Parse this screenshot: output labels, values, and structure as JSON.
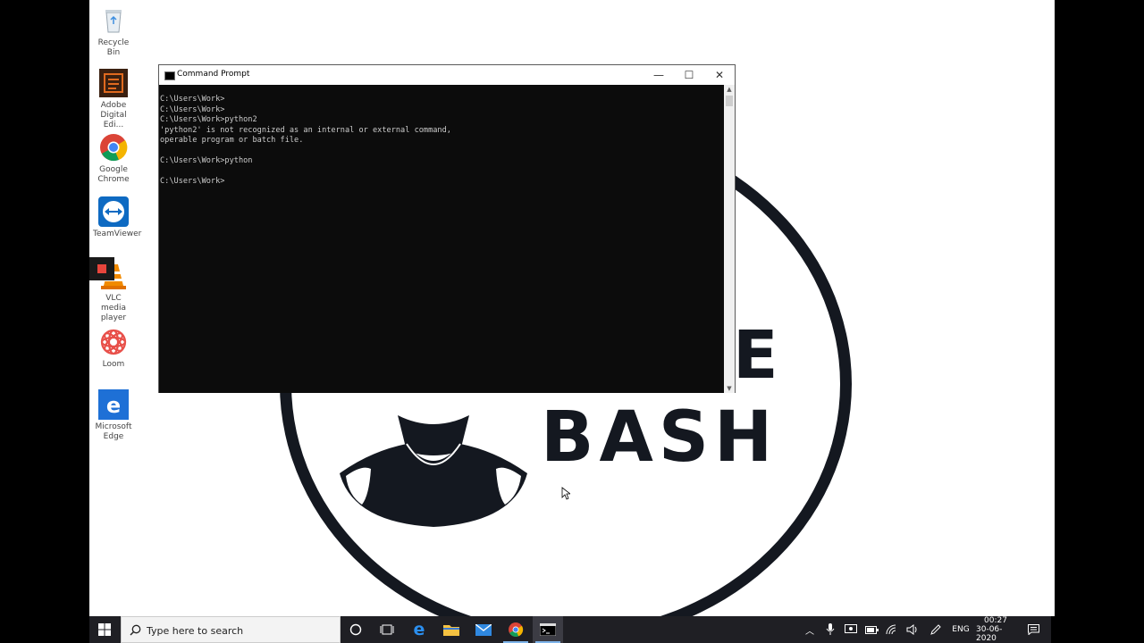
{
  "desktop_icons": [
    {
      "label": "Recycle Bin"
    },
    {
      "label": "Adobe Digital Edi..."
    },
    {
      "label": "Google Chrome"
    },
    {
      "label": "TeamViewer"
    },
    {
      "label": "VLC media player"
    },
    {
      "label": "Loom"
    },
    {
      "label": "Microsoft Edge"
    }
  ],
  "wallpaper": {
    "logo_letter": "E",
    "logo_word": "BASH"
  },
  "window": {
    "title": "Command Prompt",
    "minimize": "—",
    "maximize": "☐",
    "close": "✕",
    "console_lines": [
      "C:\\Users\\Work>",
      "C:\\Users\\Work>",
      "C:\\Users\\Work>python2",
      "'python2' is not recognized as an internal or external command,",
      "operable program or batch file.",
      "",
      "C:\\Users\\Work>python",
      "",
      "C:\\Users\\Work>"
    ]
  },
  "taskbar": {
    "search_placeholder": "Type here to search",
    "language": "ENG",
    "time": "00:27",
    "date": "30-06-2020"
  },
  "colors": {
    "taskbar": "#1f1f24",
    "console_bg": "#0c0c0c",
    "console_text": "#cccccc",
    "accent": "#7eb4ea"
  }
}
